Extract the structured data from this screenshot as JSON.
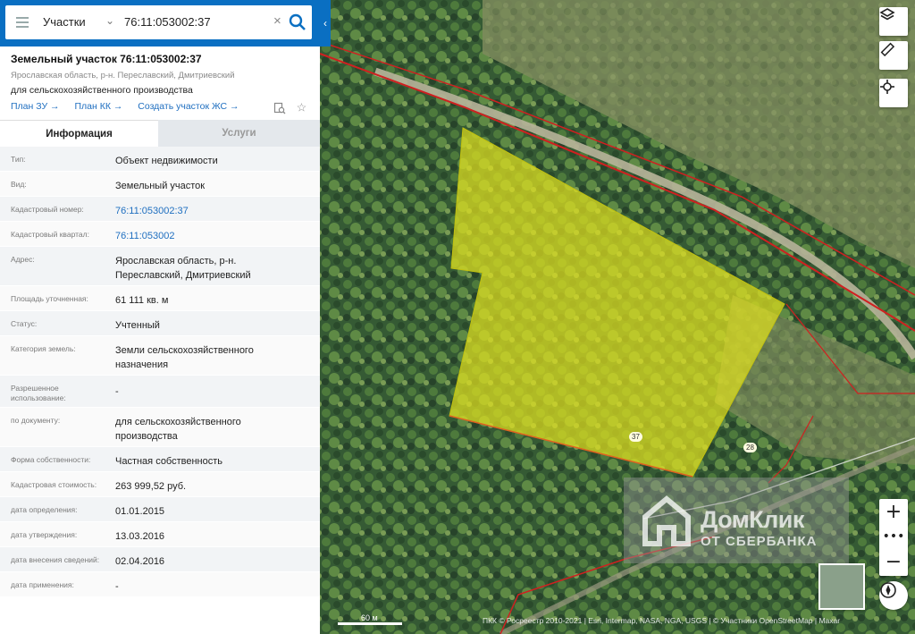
{
  "search": {
    "category": "Участки",
    "query": "76:11:053002:37"
  },
  "object": {
    "title": "Земельный участок 76:11:053002:37",
    "address": "Ярославская область, р-н. Переславский, Дмитриевский",
    "purpose": "для сельскохозяйственного производства",
    "links": [
      "План ЗУ →",
      "План КК →",
      "Создать участок ЖС →"
    ]
  },
  "tabs": {
    "info": "Информация",
    "services": "Услуги"
  },
  "info_rows": [
    {
      "label": "Тип:",
      "value": "Объект недвижимости"
    },
    {
      "label": "Вид:",
      "value": "Земельный участок"
    },
    {
      "label": "Кадастровый номер:",
      "value": "76:11:053002:37",
      "link": true
    },
    {
      "label": "Кадастровый квартал:",
      "value": "76:11:053002",
      "link": true
    },
    {
      "label": "Адрес:",
      "value": "Ярославская область, р-н. Переславский, Дмитриевский"
    },
    {
      "label": "Площадь уточненная:",
      "value": "61 111 кв. м"
    },
    {
      "label": "Статус:",
      "value": "Учтенный"
    },
    {
      "label": "Категория земель:",
      "value": "Земли сельскохозяйственного назначения"
    },
    {
      "label": "Разрешенное использование:",
      "value": "-"
    },
    {
      "label": "по документу:",
      "value": "для сельскохозяйственного производства"
    },
    {
      "label": "Форма собственности:",
      "value": "Частная собственность"
    },
    {
      "label": "Кадастровая стоимость:",
      "value": "263 999,52 руб."
    },
    {
      "label": "дата определения:",
      "value": "01.01.2015"
    },
    {
      "label": "дата утверждения:",
      "value": "13.03.2016"
    },
    {
      "label": "дата внесения сведений:",
      "value": "02.04.2016"
    },
    {
      "label": "дата применения:",
      "value": "-"
    }
  ],
  "map": {
    "parcel_labels": [
      "37",
      "28"
    ],
    "scale_label": "60 м",
    "attribution": "ПКК © Росреестр 2010-2021 | Esri, Intermap, NASA, NGA, USGS | © Участники OpenStreetMap | Maxar",
    "watermark_title": "ДомКлик",
    "watermark_sub": "ОТ СБЕРБАНКА",
    "parcel_fill": "#e0e020",
    "boundary_color": "#d02020"
  }
}
